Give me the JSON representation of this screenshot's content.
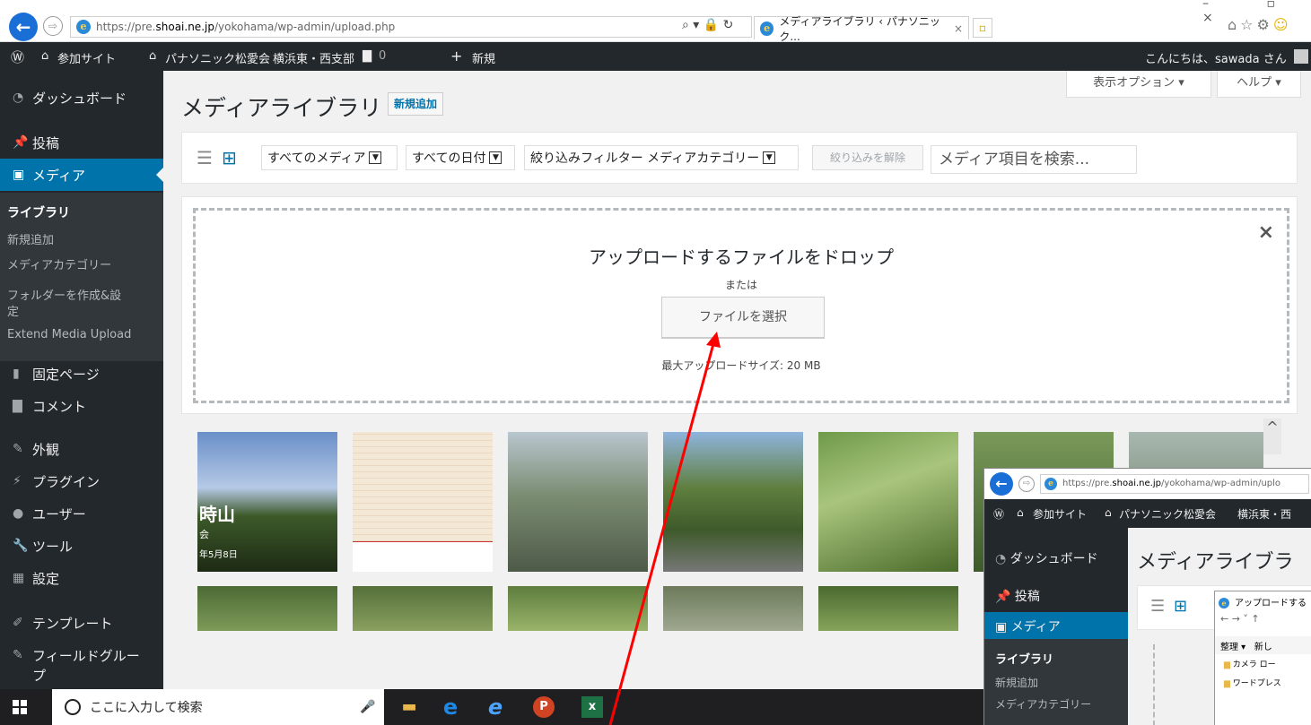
{
  "browser": {
    "url_prefix": "https://pre.",
    "url_domain": "shoai.ne.jp",
    "url_path": "/yokohama/wp-admin/upload.php",
    "addr_tools": "⌕ ▾ 🔒 ↻",
    "tab_title": "メディアライブラリ ‹ パナソニック...",
    "tab_close": "×"
  },
  "window_controls": "– ▫ ×",
  "adminbar": {
    "wp_logo": "Ⓦ",
    "sites_label": "参加サイト",
    "site_name": "パナソニック松愛会",
    "site_branch": "横浜東・西支部",
    "comments_count": "0",
    "new_label": "新規",
    "greeting": "こんにちは、sawada さん"
  },
  "sidebar": {
    "dashboard": "ダッシュボード",
    "posts": "投稿",
    "media": "メディア",
    "submenu": {
      "library": "ライブラリ",
      "add_new": "新規追加",
      "media_category": "メディアカテゴリー",
      "folder_line1": "フォルダーを作成&設",
      "folder_line2": "定",
      "extend_upload": "Extend Media Upload"
    },
    "pages": "固定ページ",
    "comments": "コメント",
    "appearance": "外観",
    "plugins": "プラグイン",
    "users": "ユーザー",
    "tools": "ツール",
    "settings": "設定",
    "templates": "テンプレート",
    "field_groups_line1": "フィールドグルー",
    "field_groups_line2": "プ"
  },
  "main": {
    "page_title": "メディアライブラリ",
    "add_new_button": "新規追加",
    "screen_options": "表示オプション ▾",
    "help": "ヘルプ ▾",
    "filters": {
      "media_type": "すべてのメディア",
      "dates": "すべての日付",
      "category": "絞り込みフィルター メディアカテゴリー",
      "clear": "絞り込みを解除",
      "search_placeholder": "メディア項目を検索..."
    },
    "uploader": {
      "drop_title": "アップロードするファイルをドロップ",
      "or": "または",
      "select_button": "ファイルを選択",
      "max_size": "最大アップロードサイズ: 20 MB",
      "close": "×"
    },
    "thumb_text": {
      "mountain_label": "時山",
      "date_label": "年5月8日",
      "group_label": "会"
    }
  },
  "taskbar": {
    "search_placeholder": "ここに入力して検索"
  },
  "inset": {
    "url_prefix": "https://pre.",
    "url_domain": "shoai.ne.jp",
    "url_path": "/yokohama/wp-admin/uplo",
    "sites_label": "参加サイト",
    "site_name": "パナソニック松愛会",
    "site_branch": "横浜東・西",
    "dashboard": "ダッシュボード",
    "posts": "投稿",
    "media": "メディア",
    "library": "ライブラリ",
    "add_new": "新規追加",
    "media_category": "メディアカテゴリー",
    "page_title": "メディアライブラ",
    "dialog_title": "アップロードする",
    "organize": "整理 ▾",
    "new_label": "新し",
    "folder1": "カメラ ロー",
    "folder2": "ワードプレス"
  },
  "colors": {
    "wp_dark": "#23282d",
    "wp_blue": "#0073aa",
    "annotation_arrow": "#ff0000"
  }
}
